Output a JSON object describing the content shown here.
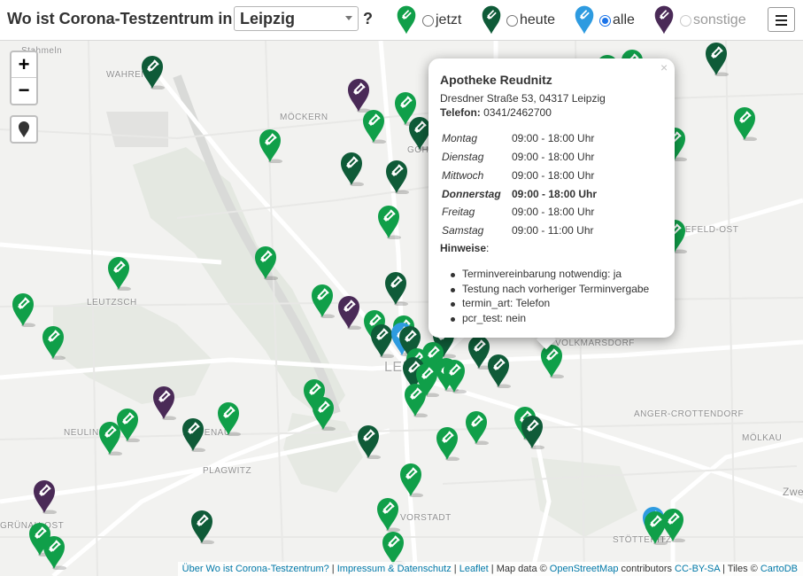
{
  "header": {
    "title": "Wo ist Corona-Testzentrum in",
    "city": "Leipzig",
    "question_mark": "?",
    "filters": [
      {
        "label": "jetzt",
        "pin_color": "#109f49",
        "checked": false,
        "disabled": false
      },
      {
        "label": "heute",
        "pin_color": "#0f5b38",
        "checked": false,
        "disabled": false
      },
      {
        "label": "alle",
        "pin_color": "#2e9be0",
        "checked": true,
        "disabled": false
      },
      {
        "label": "sonstige",
        "pin_color": "#4a2a57",
        "checked": false,
        "disabled": true
      }
    ],
    "menu_icon": "hamburger-icon"
  },
  "map": {
    "zoom_in": "+",
    "zoom_out": "−",
    "locate_icon": "map-marker-icon",
    "marker_icon": "test-tube-icon",
    "colors": {
      "open_now": "#109f49",
      "open_today": "#0f5b38",
      "selected": "#2e9be0",
      "other": "#4a2a57"
    },
    "place_labels": [
      "Stahmeln",
      "WAHREN",
      "MÖCKERN",
      "GOH",
      "LEUTZSCH",
      "NEULIN",
      "LINDENAU",
      "PLAGWITZ",
      "GRÜNAU-OST",
      "VORSTADT",
      "STÖTTERITZ",
      "MÖLKAU",
      "ANGER-CROTTENDORF",
      "VOLKMARSDORF",
      "NEFELD-OST",
      "LEI",
      "Zwe"
    ]
  },
  "popup": {
    "close": "×",
    "title": "Apotheke Reudnitz",
    "address": "Dresdner Straße 53, 04317 Leipzig",
    "phone_label": "Telefon:",
    "phone": "0341/2462700",
    "hours": [
      {
        "day": "Montag",
        "time": "09:00 - 18:00 Uhr",
        "today": false
      },
      {
        "day": "Dienstag",
        "time": "09:00 - 18:00 Uhr",
        "today": false
      },
      {
        "day": "Mittwoch",
        "time": "09:00 - 18:00 Uhr",
        "today": false
      },
      {
        "day": "Donnerstag",
        "time": "09:00 - 18:00 Uhr",
        "today": true
      },
      {
        "day": "Freitag",
        "time": "09:00 - 18:00 Uhr",
        "today": false
      },
      {
        "day": "Samstag",
        "time": "09:00 - 11:00 Uhr",
        "today": false
      }
    ],
    "notes_label": "Hinweise",
    "notes_colon": ":",
    "notes": [
      "Terminvereinbarung notwendig: ja",
      "Testung nach vorheriger Terminvergabe",
      "termin_art: Telefon",
      "pcr_test: nein"
    ]
  },
  "attribution": {
    "about": "Über Wo ist Corona-Testzentrum?",
    "sep1": " | ",
    "imprint": "Impressum & Datenschutz",
    "sep2": " | ",
    "leaflet": "Leaflet",
    "map_data": " | Map data © ",
    "osm": "OpenStreetMap",
    "contributors": " contributors ",
    "license": "CC-BY-SA",
    "tiles": " | Tiles © ",
    "carto": "CartoDB"
  }
}
